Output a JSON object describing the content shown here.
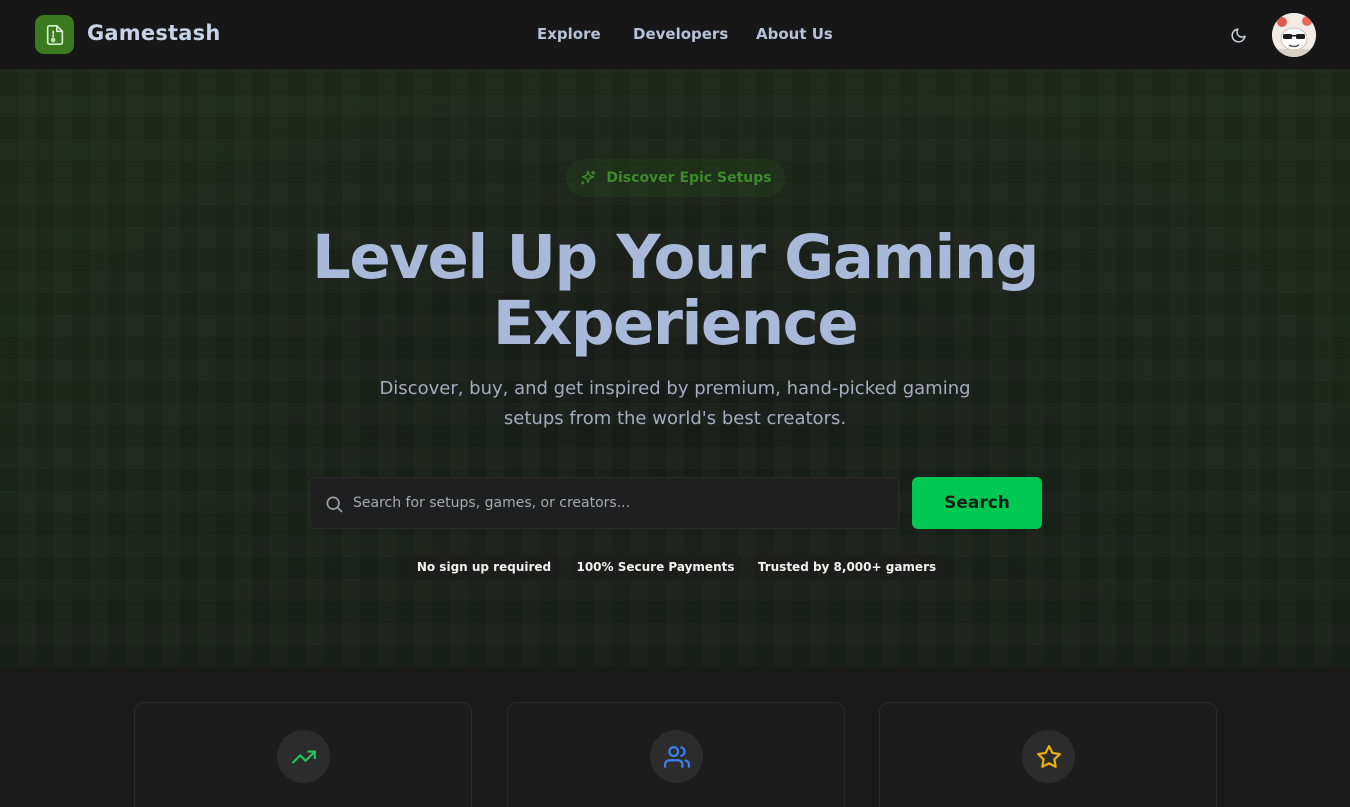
{
  "header": {
    "brand": "Gamestash",
    "nav": [
      {
        "label": "Explore"
      },
      {
        "label": "Developers"
      },
      {
        "label": "About Us"
      }
    ]
  },
  "hero": {
    "pill_label": "Discover Epic Setups",
    "title_line1": "Level Up Your Gaming",
    "title_line2": "Experience",
    "subtitle_line1": "Discover, buy, and get inspired by premium, hand-picked gaming",
    "subtitle_line2": "setups from the world's best creators.",
    "search": {
      "placeholder": "Search for setups, games, or creators...",
      "value": "",
      "button_label": "Search"
    },
    "badges": [
      {
        "label": "No sign up required"
      },
      {
        "label": "100% Secure Payments"
      },
      {
        "label": "Trusted by 8,000+ gamers"
      }
    ]
  },
  "features": [
    {
      "icon": "trending-up-icon",
      "color": "#22c55e"
    },
    {
      "icon": "users-icon",
      "color": "#3b82f6"
    },
    {
      "icon": "star-icon",
      "color": "#eab308"
    }
  ],
  "colors": {
    "accent": "#00c853",
    "brand_green": "#3b7a1f",
    "title": "#a9b9d9"
  }
}
